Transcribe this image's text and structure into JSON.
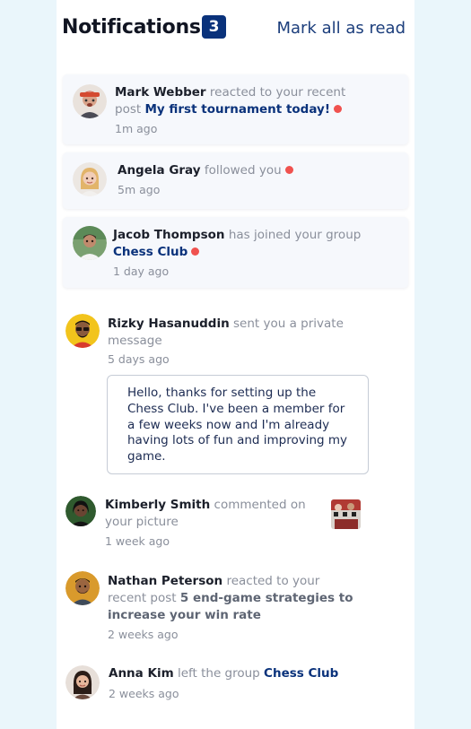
{
  "header": {
    "title": "Notifications",
    "unread_count": "3",
    "mark_all_label": "Mark all as read"
  },
  "notifications": [
    {
      "name": "Mark Webber",
      "action": "reacted to your recent post",
      "target": "My first tournament today!",
      "time": "1m ago",
      "unread": true
    },
    {
      "name": "Angela Gray",
      "action": "followed you",
      "time": "5m ago",
      "unread": true
    },
    {
      "name": "Jacob Thompson",
      "action": "has joined your group",
      "target": "Chess Club",
      "time": "1 day ago",
      "unread": true
    },
    {
      "name": "Rizky Hasanuddin",
      "action": "sent you a private message",
      "time": "5 days ago",
      "unread": false,
      "message": "Hello, thanks for setting up the Chess Club. I've been a member for a few weeks now and I'm already having lots of fun and improving my game."
    },
    {
      "name": "Kimberly Smith",
      "action": "commented on your picture",
      "time": "1 week ago",
      "unread": false
    },
    {
      "name": "Nathan Peterson",
      "action": "reacted to your recent post",
      "target": "5 end-game strategies to increase your win rate",
      "time": "2 weeks ago",
      "unread": false
    },
    {
      "name": "Anna Kim",
      "action": "left the group",
      "target": "Chess Club",
      "time": "2 weeks ago",
      "unread": false
    }
  ],
  "colors": {
    "unread_dot": "#f0524f",
    "badge": "#0a327b",
    "link": "#0a327b",
    "unread_bg": "#f6f8fc"
  }
}
